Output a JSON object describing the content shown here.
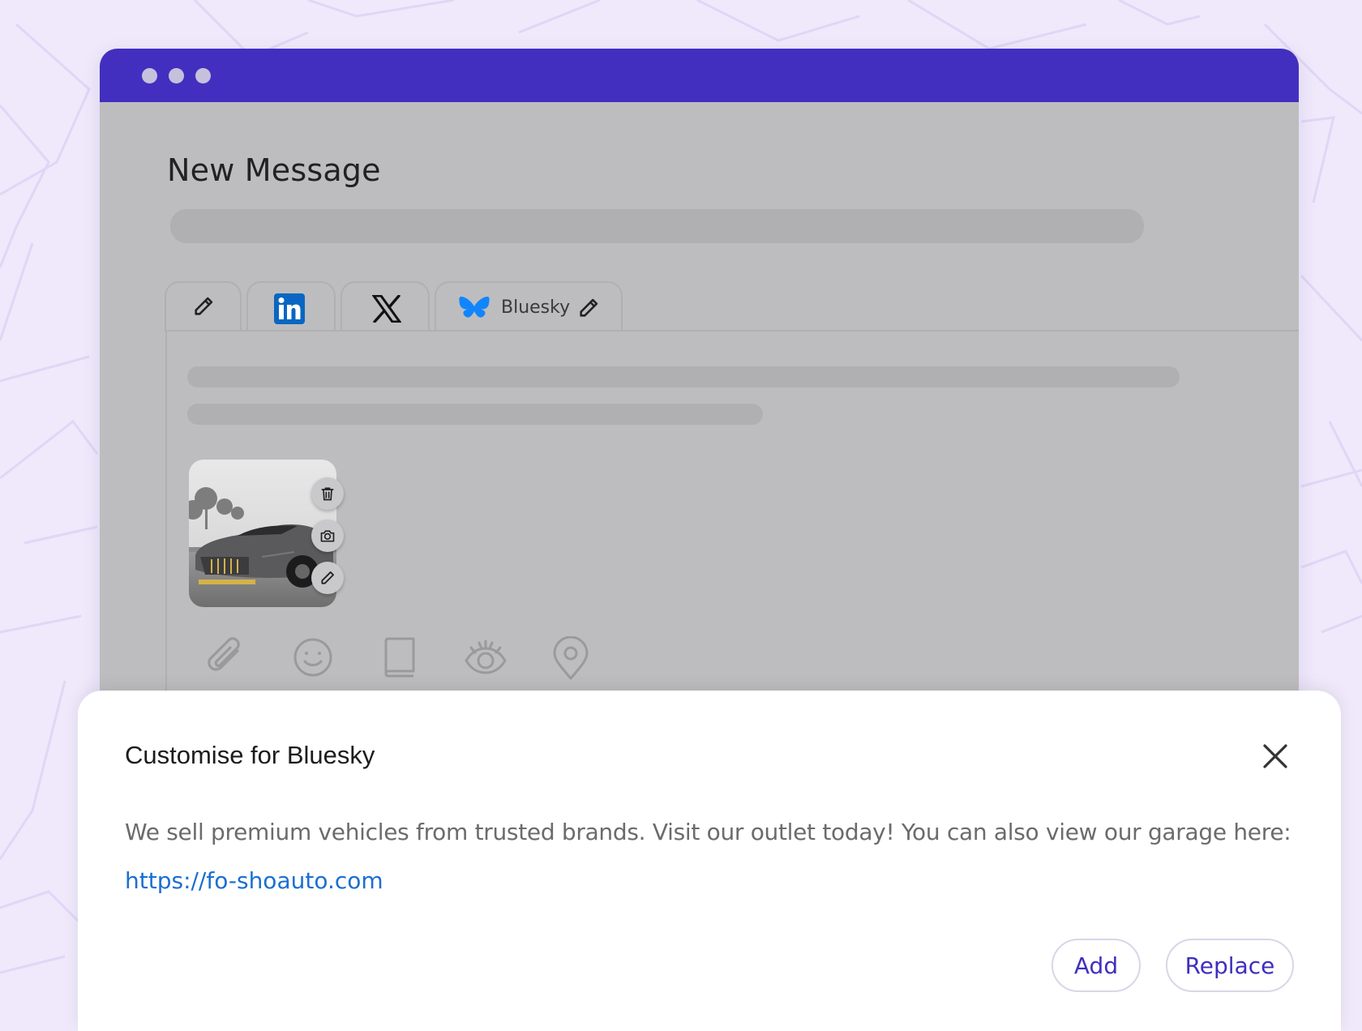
{
  "window": {
    "title": "New Message",
    "accent_color": "#422fbf"
  },
  "tabs": [
    {
      "id": "edit",
      "icon": "pencil-icon"
    },
    {
      "id": "linkedin",
      "icon": "linkedin-icon",
      "color": "#0a66c2"
    },
    {
      "id": "x",
      "icon": "x-logo-icon"
    },
    {
      "id": "bluesky",
      "icon": "butterfly-icon",
      "label": "Bluesky",
      "color": "#1185fe",
      "active": true
    }
  ],
  "attachment": {
    "icon": "car-photo",
    "actions": [
      "trash-icon",
      "camera-icon",
      "pencil-icon"
    ]
  },
  "toolbar": [
    "paperclip-icon",
    "emoji-icon",
    "book-icon",
    "eye-icon",
    "location-icon"
  ],
  "modal": {
    "title": "Customise for Bluesky",
    "body": "We sell premium vehicles from trusted brands. Visit our outlet today! You can also view our garage here:",
    "link": "https://fo-shoauto.com",
    "add_label": "Add",
    "replace_label": "Replace"
  }
}
